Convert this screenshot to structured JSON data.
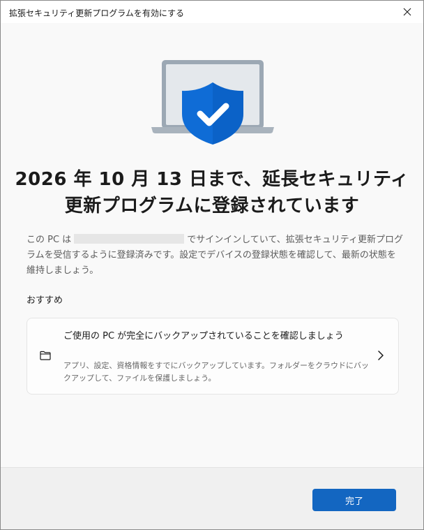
{
  "window": {
    "title": "拡張セキュリティ更新プログラムを有効にする"
  },
  "headline": "2026 年 10 月 13 日まで、延長セキュリティ更新プログラムに登録されています",
  "description": {
    "before_account": "この PC は",
    "after_account": "でサインインしていて、拡張セキュリティ更新プログラムを受信するように登録済みです。設定でデバイスの登録状態を確認して、最新の状態を維持しましょう。"
  },
  "recommendations": {
    "label": "おすすめ",
    "card": {
      "icon": "folder-icon",
      "title": "ご使用の PC が完全にバックアップされていることを確認しましょう",
      "description": "アプリ、設定、資格情報をすでにバックアップしています。フォルダーをクラウドにバックアップして、ファイルを保護しましょう。"
    }
  },
  "footer": {
    "done_label": "完了"
  },
  "colors": {
    "accent": "#1366c1",
    "shield": "#0f6cd6"
  }
}
